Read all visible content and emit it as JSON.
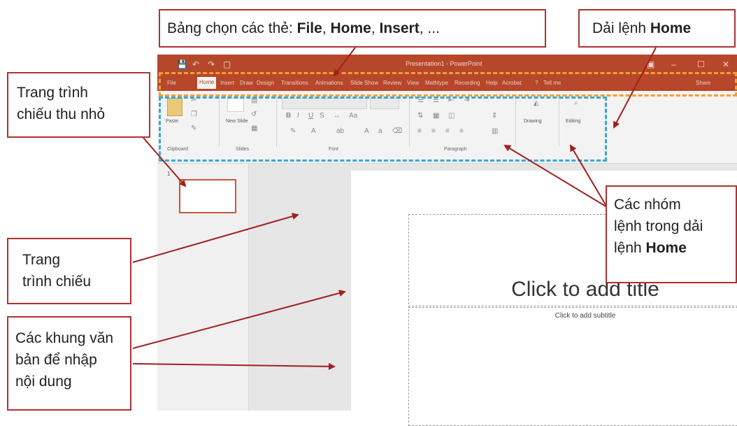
{
  "window": {
    "title": "Presentation1 - PowerPoint",
    "quick_access": [
      "💾",
      "↶",
      "↷",
      "▢"
    ],
    "controls": [
      "▣",
      "–",
      "☐",
      "✕"
    ],
    "tabs": [
      "File",
      "Home",
      "Insert",
      "Draw",
      "Design",
      "Transitions",
      "Animations",
      "Slide Show",
      "Review",
      "View",
      "Mathtype",
      "Recording",
      "Help",
      "Acrobat"
    ],
    "tell_me": "Tell me",
    "share": "Share"
  },
  "ribbon": {
    "clipboard": {
      "paste": "Paste",
      "label": "Clipboard"
    },
    "slides": {
      "new_slide": "New Slide",
      "label": "Slides"
    },
    "font": {
      "label": "Font"
    },
    "paragraph": {
      "label": "Paragraph"
    },
    "drawing": {
      "label": "Drawing"
    },
    "editing": {
      "label": "Editing"
    }
  },
  "thumbnail": {
    "number": "1"
  },
  "slide": {
    "title_placeholder": "Click to add title",
    "subtitle_placeholder": "Click to add subtitle"
  },
  "callouts": {
    "tabs": {
      "prefix": "Bảng chọn các thẻ: ",
      "file": "File",
      "sep1": ", ",
      "home": "Home",
      "sep2": ", ",
      "insert": "Insert",
      "suffix": ", ..."
    },
    "ribbon": {
      "prefix": "Dải lệnh ",
      "home": "Home"
    },
    "thumb": {
      "line1": "Trang trình",
      "line2": "chiếu thu nhỏ"
    },
    "slide": {
      "line1": "Trang",
      "line2": "trình chiếu"
    },
    "textbox": {
      "line1": "Các khung văn",
      "line2": "bản để nhập",
      "line3": "nội dung"
    },
    "groups": {
      "line1": "Các nhóm",
      "line2": "lệnh trong dải",
      "line3": "lệnh ",
      "home": "Home"
    }
  },
  "colors": {
    "accent": "#b7472a",
    "callout_border": "#b03030",
    "tabs_dash": "#f0a030",
    "ribbon_dash": "#36a9d6"
  }
}
